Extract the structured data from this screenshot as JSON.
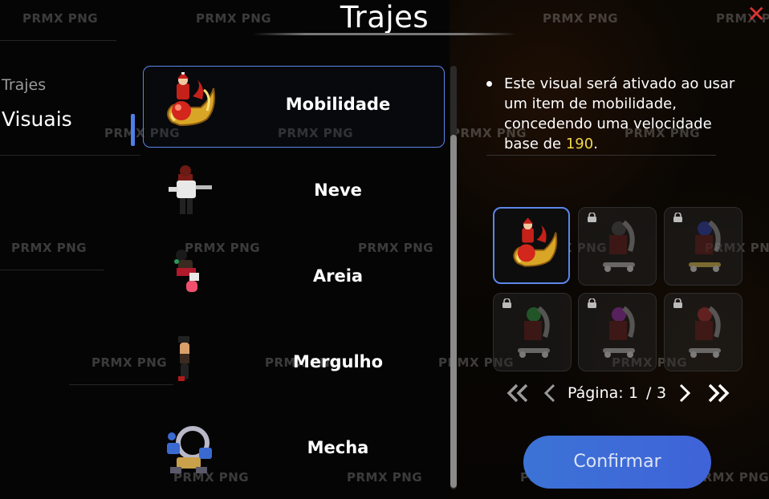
{
  "window": {
    "title": "Trajes",
    "close_glyph": "✕"
  },
  "sidebar": {
    "items": [
      {
        "label": "Trajes",
        "active": false
      },
      {
        "label": "Visuais",
        "active": true
      }
    ]
  },
  "list": {
    "items": [
      {
        "label": "Mobilidade",
        "selected": true,
        "icon": "sleigh-icon"
      },
      {
        "label": "Neve",
        "selected": false,
        "icon": "snow-outfit-icon"
      },
      {
        "label": "Areia",
        "selected": false,
        "icon": "sand-outfit-icon"
      },
      {
        "label": "Mergulho",
        "selected": false,
        "icon": "diving-outfit-icon"
      },
      {
        "label": "Mecha",
        "selected": false,
        "icon": "mecha-outfit-icon"
      }
    ]
  },
  "description": {
    "text_before": "Este visual será ativado ao usar um item de mobilidade, concedendo uma velocidade base de ",
    "value": "190",
    "text_after": "."
  },
  "grid": {
    "slots": [
      {
        "icon": "sleigh-icon",
        "locked": false,
        "selected": true
      },
      {
        "icon": "skateboard-icon",
        "locked": true,
        "selected": false
      },
      {
        "icon": "skateboard-icon",
        "locked": true,
        "selected": false
      },
      {
        "icon": "skateboard-icon",
        "locked": true,
        "selected": false
      },
      {
        "icon": "skateboard-icon",
        "locked": true,
        "selected": false
      },
      {
        "icon": "skateboard-icon",
        "locked": true,
        "selected": false
      }
    ]
  },
  "pager": {
    "label": "Página:",
    "current": "1",
    "separator": "/",
    "total": "3"
  },
  "confirm_label": "Confirmar",
  "watermark": "PRMX PNG",
  "colors": {
    "accent": "#5c86e8",
    "value": "#f2d64b",
    "close": "#dd3333",
    "button": "#3c6fd8"
  }
}
